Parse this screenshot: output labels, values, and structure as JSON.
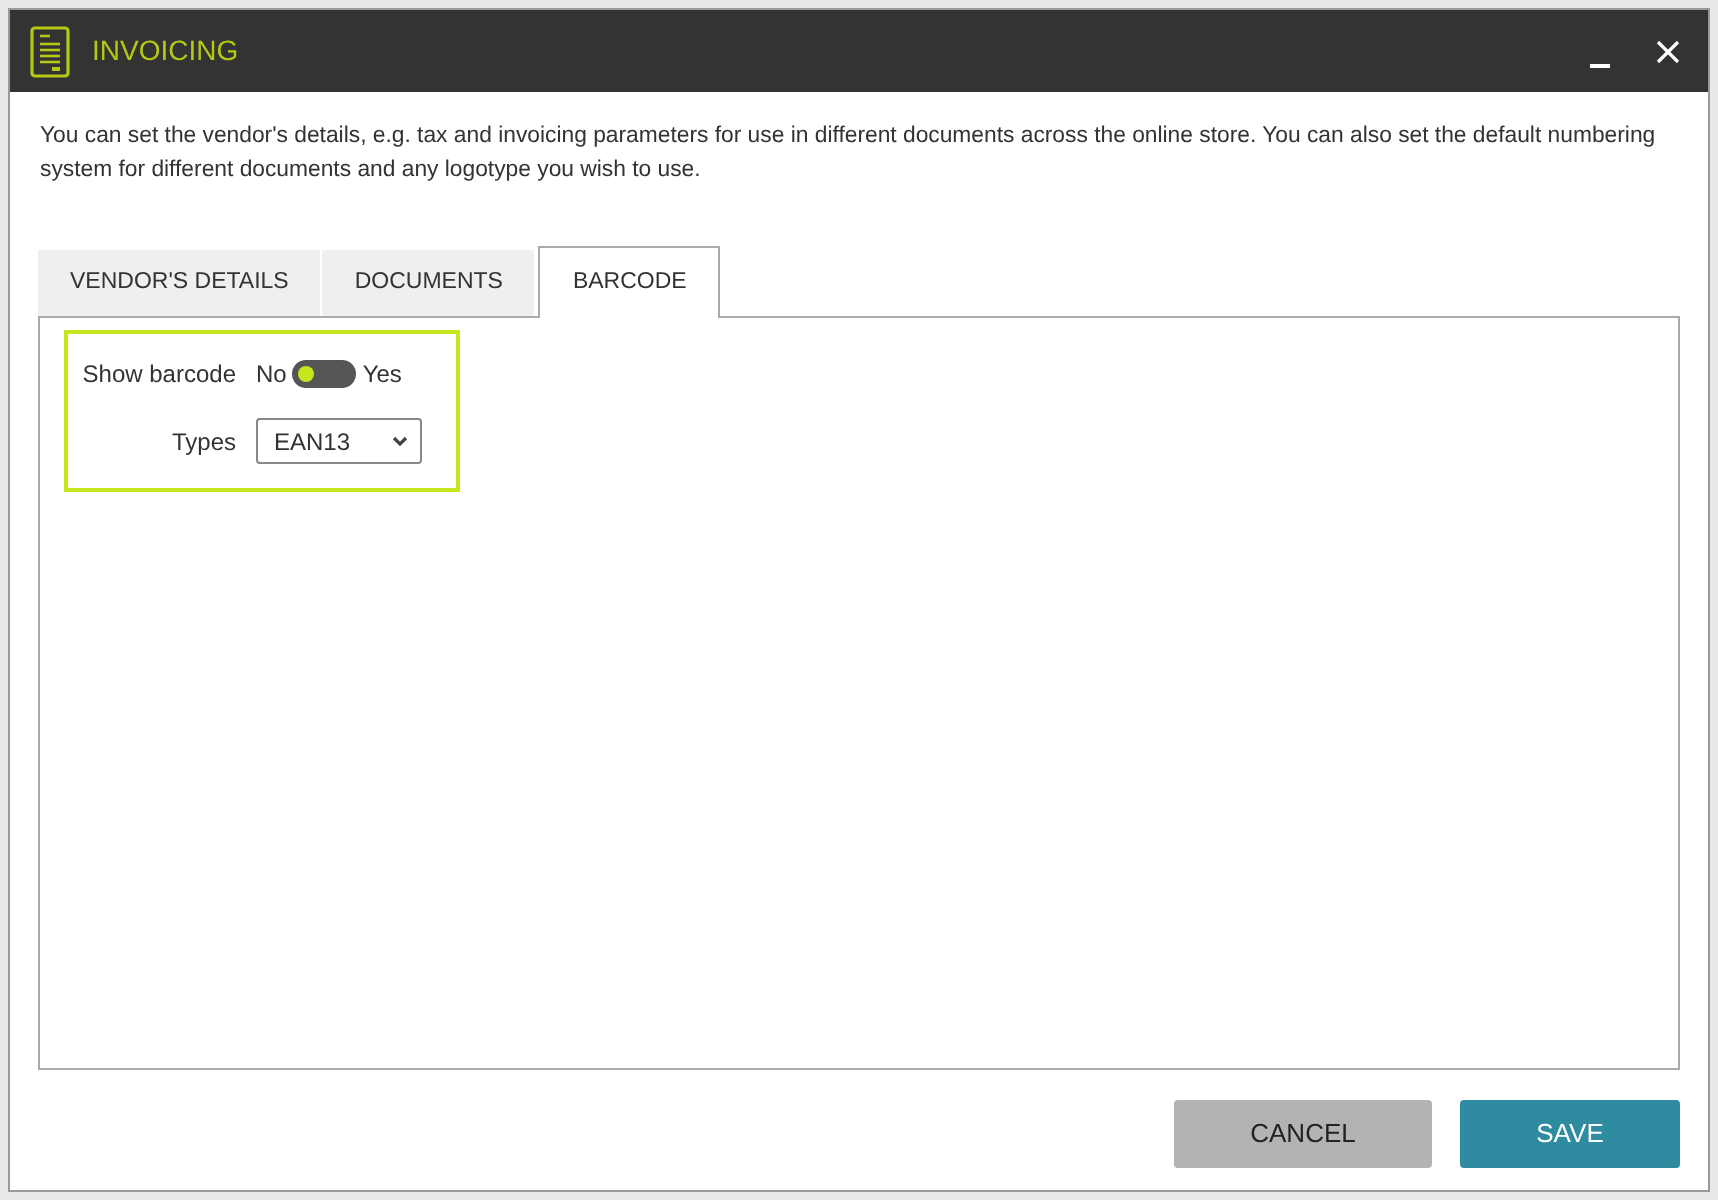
{
  "window": {
    "title": "INVOICING"
  },
  "description": "You can set the vendor's details, e.g. tax and invoicing parameters for use in different documents across the online store. You can also set the default numbering system for different documents and any logotype you wish to use.",
  "tabs": [
    {
      "label": "VENDOR'S DETAILS",
      "selected": false
    },
    {
      "label": "DOCUMENTS",
      "selected": false
    },
    {
      "label": "BARCODE",
      "selected": true
    }
  ],
  "barcode_settings": {
    "show_barcode": {
      "label": "Show barcode",
      "off_label": "No",
      "on_label": "Yes",
      "on": false
    },
    "types": {
      "label": "Types",
      "value": "EAN13"
    }
  },
  "buttons": [
    {
      "label": "CANCEL",
      "kind": "secondary"
    },
    {
      "label": "SAVE",
      "kind": "primary"
    }
  ]
}
